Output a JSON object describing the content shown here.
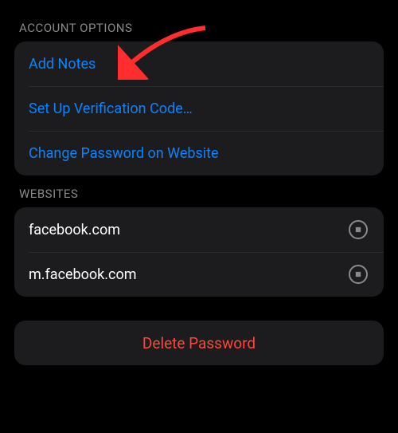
{
  "sections": {
    "account_options": {
      "title": "ACCOUNT OPTIONS",
      "items": {
        "add_notes": "Add Notes",
        "setup_code": "Set Up Verification Code…",
        "change_pw": "Change Password on Website"
      }
    },
    "websites": {
      "title": "WEBSITES",
      "items": [
        "facebook.com",
        "m.facebook.com"
      ]
    },
    "delete": {
      "label": "Delete Password"
    }
  }
}
